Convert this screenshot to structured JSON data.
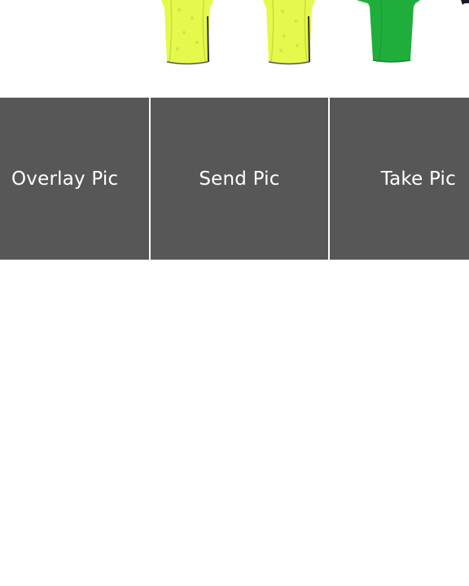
{
  "gallery": {
    "items": [
      {
        "icon": "yellow-shirt-icon",
        "color": "#e4f94b"
      },
      {
        "icon": "yellow-shirt-icon",
        "color": "#e4f94b"
      },
      {
        "icon": "green-shirt-icon",
        "color": "#1fae3b"
      },
      {
        "icon": "dark-shirt-icon",
        "color": "#1a1a2e"
      }
    ]
  },
  "actions": {
    "overlay_label": "Overlay Pic",
    "send_label": "Send Pic",
    "take_label": "Take Pic",
    "button_color": "#575757",
    "text_color": "#ffffff"
  }
}
